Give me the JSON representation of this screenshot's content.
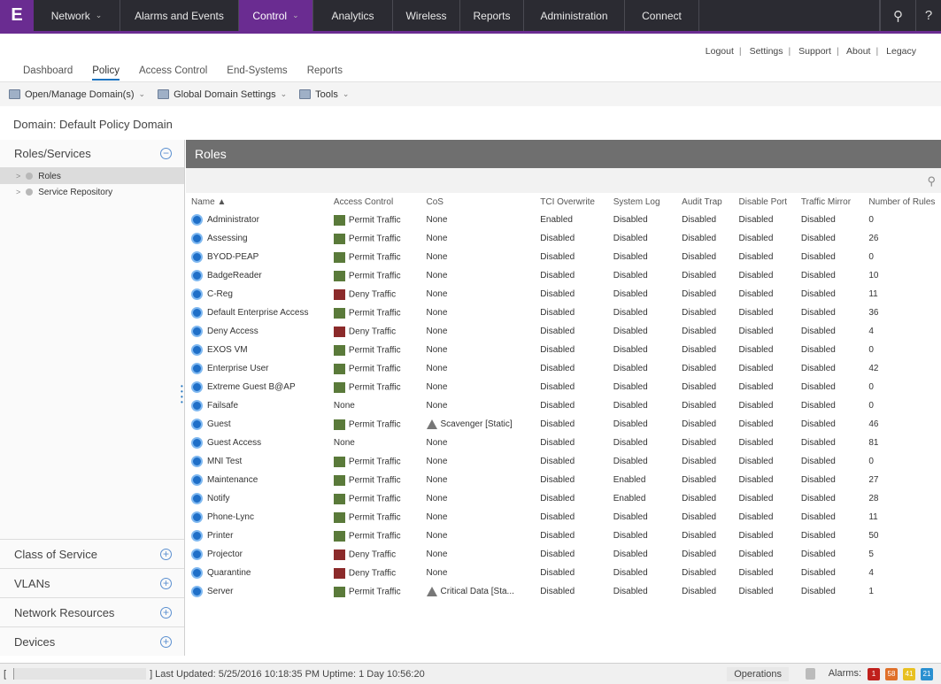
{
  "nav": {
    "logo": "E",
    "items": [
      {
        "label": "Network",
        "dropdown": true
      },
      {
        "label": "Alarms and Events",
        "dropdown": false
      },
      {
        "label": "Control",
        "dropdown": true,
        "active": true
      },
      {
        "label": "Analytics",
        "dropdown": false
      },
      {
        "label": "Wireless",
        "dropdown": false
      },
      {
        "label": "Reports",
        "dropdown": false
      },
      {
        "label": "Administration",
        "dropdown": false
      },
      {
        "label": "Connect",
        "dropdown": false
      }
    ],
    "search_icon": "⚲",
    "help_icon": "?"
  },
  "toplinks": [
    "Logout",
    "Settings",
    "Support",
    "About",
    "Legacy"
  ],
  "tabs": [
    "Dashboard",
    "Policy",
    "Access Control",
    "End-Systems",
    "Reports"
  ],
  "active_tab": "Policy",
  "toolbar": {
    "open_manage": "Open/Manage Domain(s)",
    "global_settings": "Global Domain Settings",
    "tools": "Tools"
  },
  "domain_line": "Domain: Default Policy Domain",
  "left": {
    "header": "Roles/Services",
    "tree": [
      "Roles",
      "Service Repository"
    ],
    "accordions": [
      "Class of Service",
      "VLANs",
      "Network Resources",
      "Devices"
    ]
  },
  "roles": {
    "title": "Roles",
    "columns": [
      "Name ▲",
      "Access Control",
      "CoS",
      "TCI Overwrite",
      "System Log",
      "Audit Trap",
      "Disable Port",
      "Traffic Mirror",
      "Number of Rules"
    ],
    "rows": [
      [
        "Administrator",
        "Permit Traffic",
        "None",
        "Enabled",
        "Disabled",
        "Disabled",
        "Disabled",
        "Disabled",
        "0"
      ],
      [
        "Assessing",
        "Permit Traffic",
        "None",
        "Disabled",
        "Disabled",
        "Disabled",
        "Disabled",
        "Disabled",
        "26"
      ],
      [
        "BYOD-PEAP",
        "Permit Traffic",
        "None",
        "Disabled",
        "Disabled",
        "Disabled",
        "Disabled",
        "Disabled",
        "0"
      ],
      [
        "BadgeReader",
        "Permit Traffic",
        "None",
        "Disabled",
        "Disabled",
        "Disabled",
        "Disabled",
        "Disabled",
        "10"
      ],
      [
        "C-Reg",
        "Deny Traffic",
        "None",
        "Disabled",
        "Disabled",
        "Disabled",
        "Disabled",
        "Disabled",
        "11"
      ],
      [
        "Default Enterprise Access",
        "Permit Traffic",
        "None",
        "Disabled",
        "Disabled",
        "Disabled",
        "Disabled",
        "Disabled",
        "36"
      ],
      [
        "Deny Access",
        "Deny Traffic",
        "None",
        "Disabled",
        "Disabled",
        "Disabled",
        "Disabled",
        "Disabled",
        "4"
      ],
      [
        "EXOS VM",
        "Permit Traffic",
        "None",
        "Disabled",
        "Disabled",
        "Disabled",
        "Disabled",
        "Disabled",
        "0"
      ],
      [
        "Enterprise User",
        "Permit Traffic",
        "None",
        "Disabled",
        "Disabled",
        "Disabled",
        "Disabled",
        "Disabled",
        "42"
      ],
      [
        "Extreme Guest B@AP",
        "Permit Traffic",
        "None",
        "Disabled",
        "Disabled",
        "Disabled",
        "Disabled",
        "Disabled",
        "0"
      ],
      [
        "Failsafe",
        "None",
        "None",
        "Disabled",
        "Disabled",
        "Disabled",
        "Disabled",
        "Disabled",
        "0"
      ],
      [
        "Guest",
        "Permit Traffic",
        "Scavenger [Static]",
        "Disabled",
        "Disabled",
        "Disabled",
        "Disabled",
        "Disabled",
        "46"
      ],
      [
        "Guest Access",
        "None",
        "None",
        "Disabled",
        "Disabled",
        "Disabled",
        "Disabled",
        "Disabled",
        "81"
      ],
      [
        "MNI Test",
        "Permit Traffic",
        "None",
        "Disabled",
        "Disabled",
        "Disabled",
        "Disabled",
        "Disabled",
        "0"
      ],
      [
        "Maintenance",
        "Permit Traffic",
        "None",
        "Disabled",
        "Enabled",
        "Disabled",
        "Disabled",
        "Disabled",
        "27"
      ],
      [
        "Notify",
        "Permit Traffic",
        "None",
        "Disabled",
        "Enabled",
        "Disabled",
        "Disabled",
        "Disabled",
        "28"
      ],
      [
        "Phone-Lync",
        "Permit Traffic",
        "None",
        "Disabled",
        "Disabled",
        "Disabled",
        "Disabled",
        "Disabled",
        "11"
      ],
      [
        "Printer",
        "Permit Traffic",
        "None",
        "Disabled",
        "Disabled",
        "Disabled",
        "Disabled",
        "Disabled",
        "50"
      ],
      [
        "Projector",
        "Deny Traffic",
        "None",
        "Disabled",
        "Disabled",
        "Disabled",
        "Disabled",
        "Disabled",
        "5"
      ],
      [
        "Quarantine",
        "Deny Traffic",
        "None",
        "Disabled",
        "Disabled",
        "Disabled",
        "Disabled",
        "Disabled",
        "4"
      ],
      [
        "Server",
        "Permit Traffic",
        "Critical Data [Sta...",
        "Disabled",
        "Disabled",
        "Disabled",
        "Disabled",
        "Disabled",
        "1"
      ]
    ]
  },
  "status": {
    "text": "] Last Updated: 5/25/2016 10:18:35 PM  Uptime: 1 Day 10:56:20",
    "operations": "Operations",
    "alarms_label": "Alarms:",
    "badges": [
      {
        "count": "1",
        "color": "#c0201c"
      },
      {
        "count": "58",
        "color": "#e0702a"
      },
      {
        "count": "41",
        "color": "#e8c020"
      },
      {
        "count": "21",
        "color": "#2a90d0"
      }
    ]
  }
}
